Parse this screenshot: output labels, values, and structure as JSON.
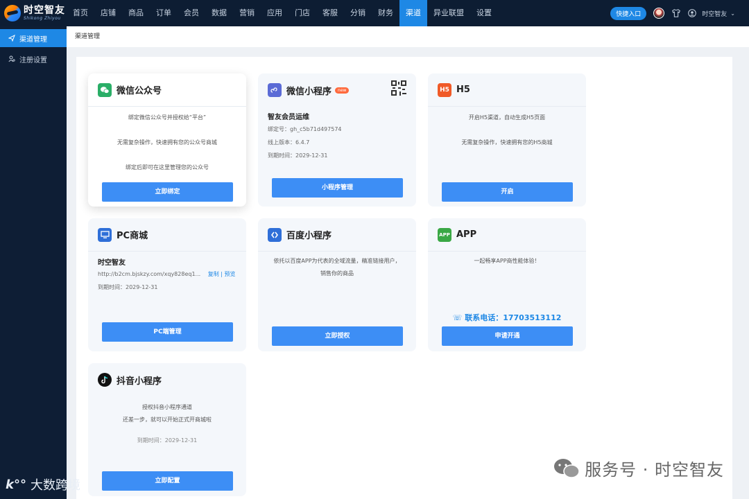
{
  "app": {
    "logo_cn": "时空智友",
    "logo_en": "Shikong Zhiyou"
  },
  "nav": [
    "首页",
    "店铺",
    "商品",
    "订单",
    "会员",
    "数据",
    "营销",
    "应用",
    "门店",
    "客服",
    "分销",
    "财务",
    "渠道",
    "异业联盟",
    "设置"
  ],
  "nav_active": "渠道",
  "header": {
    "quick_entry": "快捷入口",
    "user_name": "时空智友"
  },
  "sidebar": {
    "items": [
      {
        "label": "渠道管理",
        "active": true
      },
      {
        "label": "注册设置",
        "active": false
      }
    ]
  },
  "breadcrumb": "渠道管理",
  "cards": {
    "wechat_oa": {
      "title": "微信公众号",
      "lines": [
        "绑定微信公众号并授权给“平台”",
        "无需复杂操作，快速拥有您的公众号商城",
        "绑定后即可在这里管理您的公众号"
      ],
      "button": "立即绑定"
    },
    "wechat_mp": {
      "title": "微信小程序",
      "badge": "new",
      "name": "智友会员运维",
      "appid": "绑定号：gh_c5b71d497574",
      "version": "线上版本：6.4.7",
      "expire": "到期时间：2029-12-31",
      "button": "小程序管理"
    },
    "h5": {
      "title": "H5",
      "lines": [
        "开启H5渠道，自动生成H5页面",
        "无需复杂操作，快速拥有您的H5商城"
      ],
      "button": "开启"
    },
    "pc": {
      "title": "PC商城",
      "name": "时空智友",
      "url": "http://b2cm.bjskzy.com/xqy828eq1...",
      "copy": "复制",
      "sep": " | ",
      "preview": "预览",
      "expire": "到期时间：2029-12-31",
      "button": "PC端管理"
    },
    "baidu": {
      "title": "百度小程序",
      "lines": [
        "依托以百度APP为代表的全域流量，精准链接用户，",
        "销售你的商品"
      ],
      "button": "立即授权"
    },
    "app": {
      "title": "APP",
      "lines": [
        "一起畅享APP商性能体验！"
      ],
      "phone": "联系电话：17703513112",
      "button": "申请开通"
    },
    "douyin": {
      "title": "抖音小程序",
      "lines": [
        "授权抖音小程序通道",
        "还差一步，就可以开始正式开商城啦"
      ],
      "expire": "到期时间：2029-12-31",
      "button": "立即配置"
    }
  },
  "watermarks": {
    "main": "服务号 · 时空智友",
    "corner": "大数跨境"
  },
  "colors": {
    "topbar": "#0d1d33",
    "accent": "#1e88e5",
    "button": "#3d8ef5",
    "wechat": "#2aae67",
    "h5": "#f05a28",
    "app": "#3aa845"
  }
}
